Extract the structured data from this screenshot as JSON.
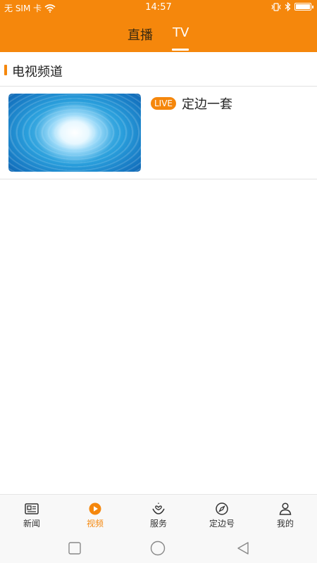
{
  "status_bar": {
    "carrier": "无 SIM 卡",
    "time": "14:57"
  },
  "top_tabs": [
    {
      "label": "直播",
      "active": false
    },
    {
      "label": "TV",
      "active": true
    }
  ],
  "section": {
    "title": "电视频道"
  },
  "channels": [
    {
      "badge": "LIVE",
      "name": "定边一套"
    }
  ],
  "bottom_nav": [
    {
      "label": "新闻",
      "icon": "newspaper-icon",
      "active": false
    },
    {
      "label": "视频",
      "icon": "play-circle-icon",
      "active": true
    },
    {
      "label": "服务",
      "icon": "hand-heart-icon",
      "active": false
    },
    {
      "label": "定边号",
      "icon": "compass-icon",
      "active": false
    },
    {
      "label": "我的",
      "icon": "person-icon",
      "active": false
    }
  ],
  "colors": {
    "accent": "#f5870c",
    "header_bg": "#f5870c",
    "divider": "#e2e2e2"
  }
}
